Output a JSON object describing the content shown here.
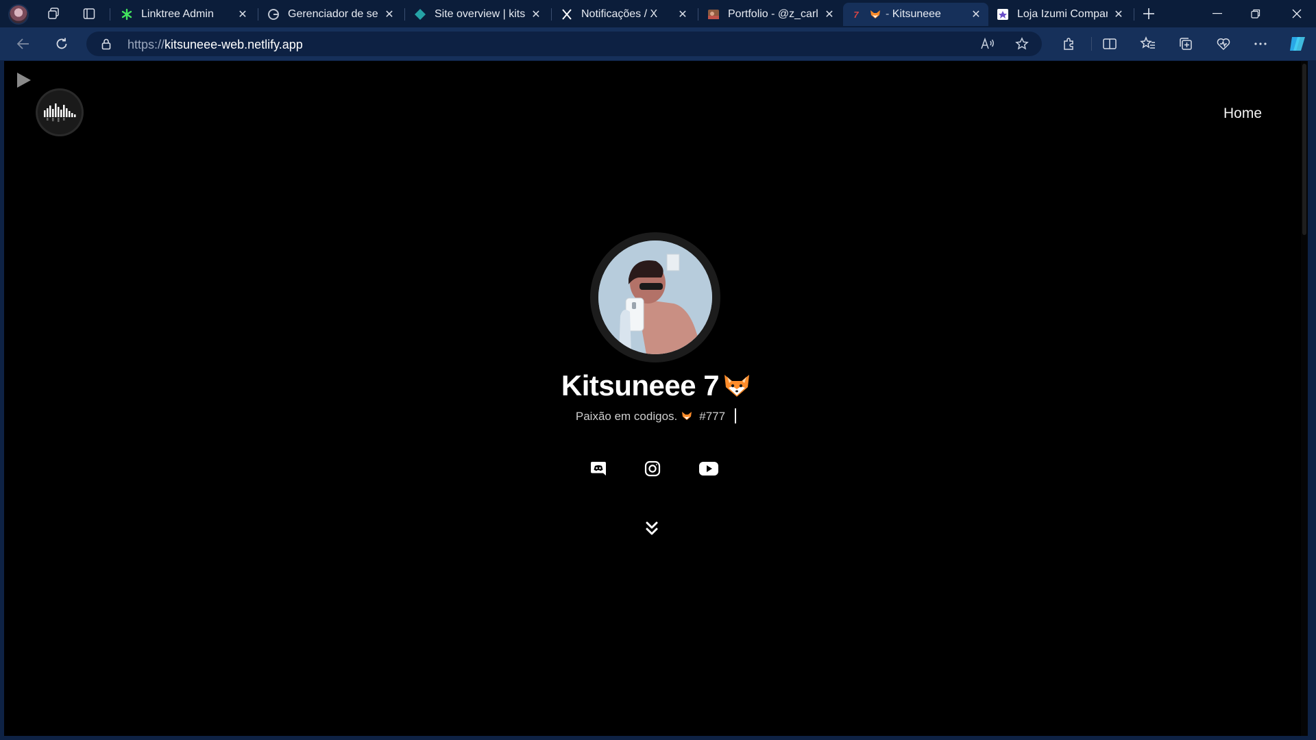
{
  "browser": {
    "tabs": [
      {
        "title": "Linktree Admin",
        "favicon": "linktree-asterisk",
        "favicon_color": "#43e55e"
      },
      {
        "title": "Gerenciador de senhas",
        "favicon": "google-g",
        "favicon_color": "#ffffff"
      },
      {
        "title": "Site overview | kitsuneee",
        "favicon": "netlify-diamond",
        "favicon_color": "#25a3a6"
      },
      {
        "title": "Notificações / X",
        "favicon": "x-logo",
        "favicon_color": "#ffffff"
      },
      {
        "title": "Portfolio - @z_carlos",
        "favicon": "portfolio-image",
        "favicon_color": "#c0524a"
      },
      {
        "title": "Kitsuneee",
        "prefix": "7",
        "favicon": "fox-emoji",
        "favicon_color": "#ff8c2a",
        "active": true
      },
      {
        "title": "Loja Izumi Company",
        "favicon": "izumi-logo",
        "favicon_color": "#6a4fc8"
      }
    ],
    "address": {
      "scheme": "https://",
      "host": "kitsuneee-web.netlify.app"
    }
  },
  "page": {
    "nav": {
      "home_label": "Home"
    },
    "profile": {
      "name": "Kitsuneee 7",
      "tagline_text": "Paixão em codigos.",
      "tagline_tag": "#777"
    },
    "socials": [
      "discord-icon",
      "instagram-icon",
      "youtube-icon"
    ],
    "colors": {
      "background": "#000000",
      "text": "#ffffff",
      "accent_fox": "#ff8c2a"
    }
  }
}
